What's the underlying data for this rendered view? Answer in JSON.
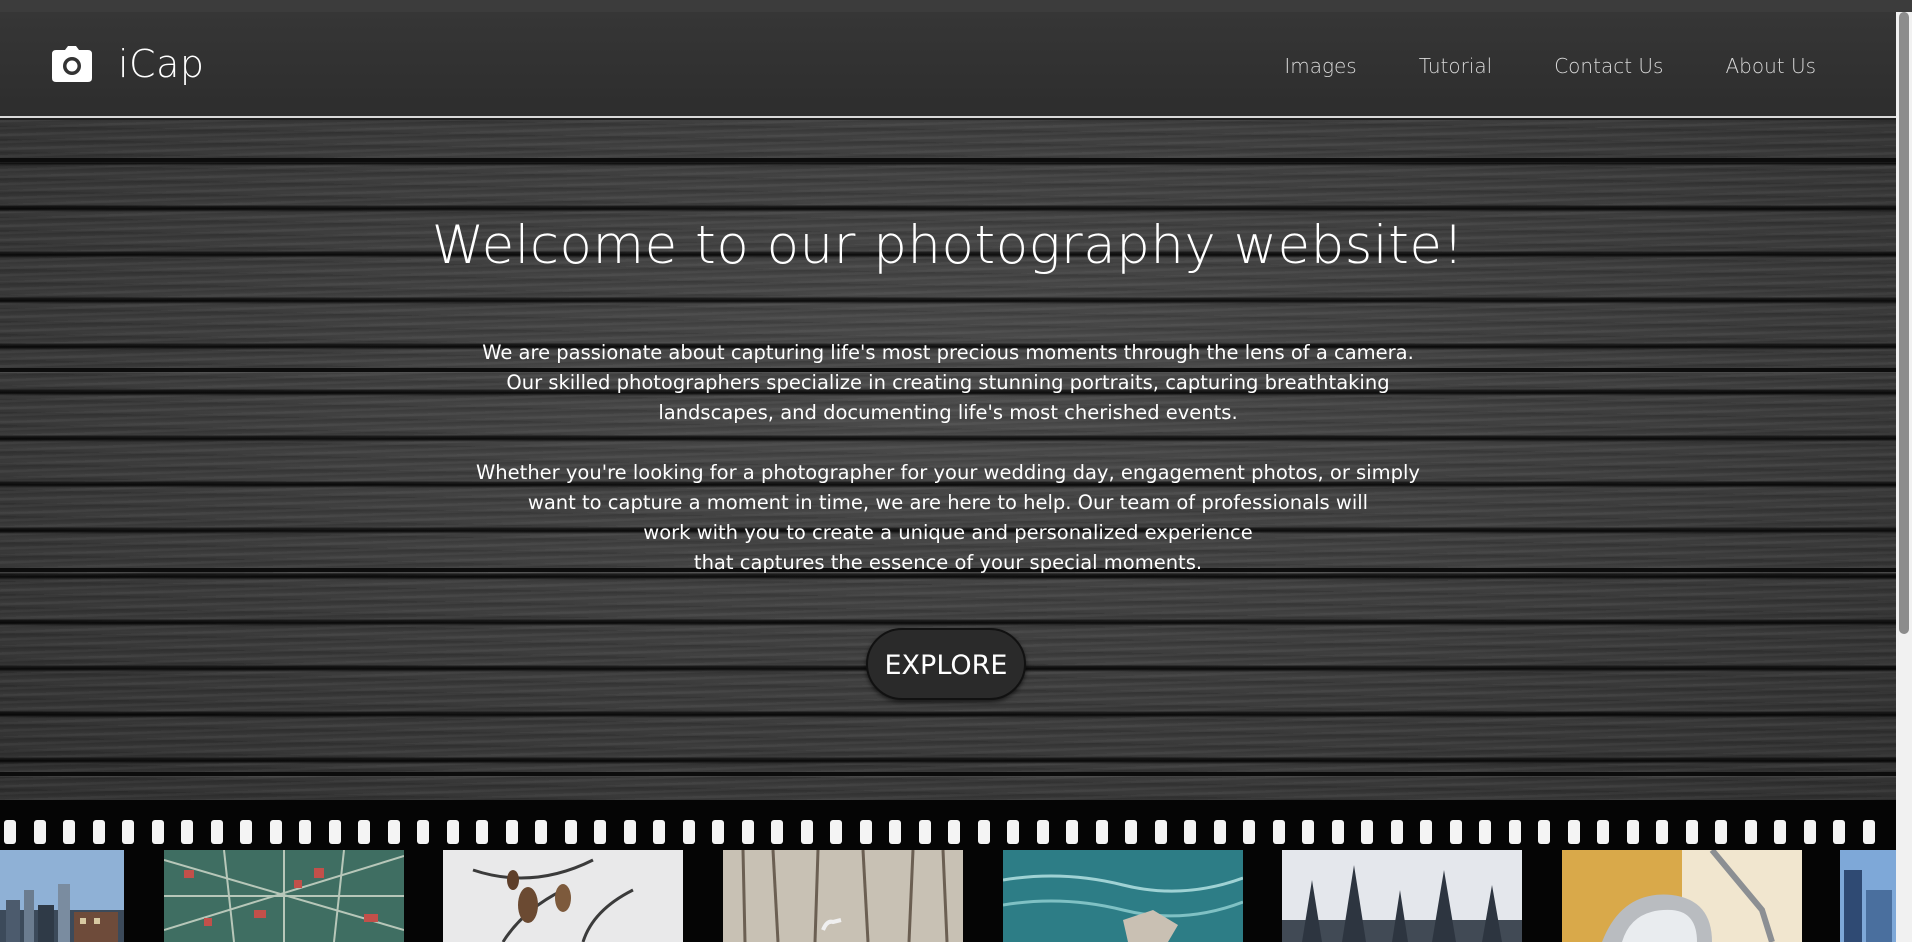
{
  "brand": {
    "name": "iCap",
    "icon": "camera-icon"
  },
  "nav": {
    "items": [
      {
        "label": "Images"
      },
      {
        "label": "Tutorial"
      },
      {
        "label": "Contact Us"
      },
      {
        "label": "About Us"
      }
    ]
  },
  "hero": {
    "title": "Welcome to our photography website!",
    "paragraph1": [
      "We are passionate about capturing life's most precious moments through the lens of a camera.",
      "Our skilled photographers specialize in creating stunning portraits, capturing breathtaking",
      "landscapes, and documenting life's most cherished events."
    ],
    "paragraph2": [
      "Whether you're looking for a photographer for your wedding day, engagement photos, or simply",
      "want to capture a moment in time, we are here to help. Our team of professionals will",
      "work with you to create a unique and personalized experience",
      "that captures the essence of your special moments."
    ],
    "button_label": "EXPLORE"
  },
  "film_strip": {
    "frames": [
      {
        "subject": "city-skyline"
      },
      {
        "subject": "aerial-city-map"
      },
      {
        "subject": "dry-leaves-branch"
      },
      {
        "subject": "heron-in-trees"
      },
      {
        "subject": "ocean-waves-rock"
      },
      {
        "subject": "forest-winter"
      },
      {
        "subject": "chrome-car-detail"
      },
      {
        "subject": "city-buildings"
      }
    ]
  },
  "colors": {
    "navbar": "#333333",
    "hero_text": "#ffffff",
    "nav_text": "#d9d9d9",
    "button_bg": "#2a2a2a"
  }
}
